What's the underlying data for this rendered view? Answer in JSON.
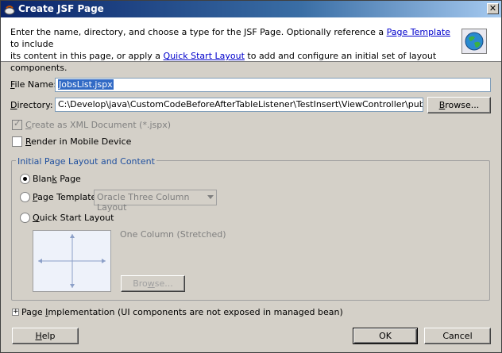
{
  "window": {
    "title": "Create JSF Page"
  },
  "header": {
    "line1_prefix": "Enter the name, directory, and choose a type for the JSF Page. Optionally reference a ",
    "page_template_link": "Page Template",
    "line1_suffix": " to include",
    "line2_prefix": "its content in this page, or apply a ",
    "quick_start_link": "Quick Start Layout",
    "line2_suffix": " to add and configure an initial set of layout components."
  },
  "form": {
    "file_name_label_mn": "F",
    "file_name_label_rest": "ile Name:",
    "file_name_value": "JobsList.jspx",
    "directory_label_mn": "D",
    "directory_label_rest": "irectory:",
    "directory_value": "C:\\Develop\\java\\CustomCodeBeforeAfterTableListener\\TestInsert\\ViewController\\public_html",
    "browse_label_mn": "B",
    "browse_label_rest": "rowse...",
    "xml_doc_label_mn": "C",
    "xml_doc_label_rest": "reate as XML Document (*.jspx)",
    "mobile_label_mn": "R",
    "mobile_label_rest": "ender in Mobile Device"
  },
  "layout_group": {
    "title": "Initial Page Layout and Content",
    "blank_page_pre": "Blan",
    "blank_page_mn": "k",
    "blank_page_post": " Page",
    "page_template_mn": "P",
    "page_template_rest": "age Template",
    "template_combo_value": "Oracle Three Column Layout",
    "quick_start_mn": "Q",
    "quick_start_rest": "uick Start Layout",
    "layout_name": "One Column (Stretched)",
    "browse_label_mn": "w",
    "browse_label_pre": "Bro",
    "browse_label_post": "se..."
  },
  "footer": {
    "impl_pre": "Page ",
    "impl_mn": "I",
    "impl_rest": "mplementation",
    "impl_note": " (UI components are not exposed in managed bean)",
    "expander_glyph": "+",
    "help_mn": "H",
    "help_rest": "elp",
    "ok_label": "OK",
    "cancel_label": "Cancel"
  },
  "colors": {
    "title_start": "#0a246a",
    "title_end": "#a6caf0",
    "link": "#0000cc",
    "selection": "#316ac5"
  }
}
